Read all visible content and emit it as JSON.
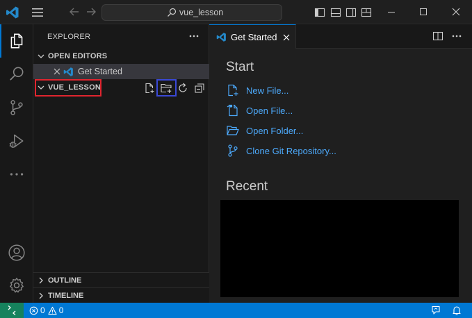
{
  "titlebar": {
    "search_text": "vue_lesson"
  },
  "sidebar": {
    "title": "EXPLORER",
    "open_editors": {
      "label": "OPEN EDITORS",
      "items": [
        {
          "label": "Get Started"
        }
      ]
    },
    "folder": {
      "label": "VUE_LESSON"
    },
    "outline_label": "OUTLINE",
    "timeline_label": "TIMELINE"
  },
  "editor": {
    "tab_label": "Get Started",
    "start_heading": "Start",
    "start_items": [
      {
        "label": "New File..."
      },
      {
        "label": "Open File..."
      },
      {
        "label": "Open Folder..."
      },
      {
        "label": "Clone Git Repository..."
      }
    ],
    "recent_heading": "Recent"
  },
  "statusbar": {
    "errors": "0",
    "warnings": "0"
  },
  "colors": {
    "accent": "#0078d4",
    "link": "#4daafc",
    "remote": "#16825d",
    "highlight_red": "#e0252f",
    "highlight_blue": "#3a49d6"
  },
  "icons": {
    "activity": [
      "explorer-icon",
      "search-icon",
      "source-control-icon",
      "run-debug-icon",
      "more-icon",
      "account-icon",
      "settings-gear-icon"
    ]
  }
}
